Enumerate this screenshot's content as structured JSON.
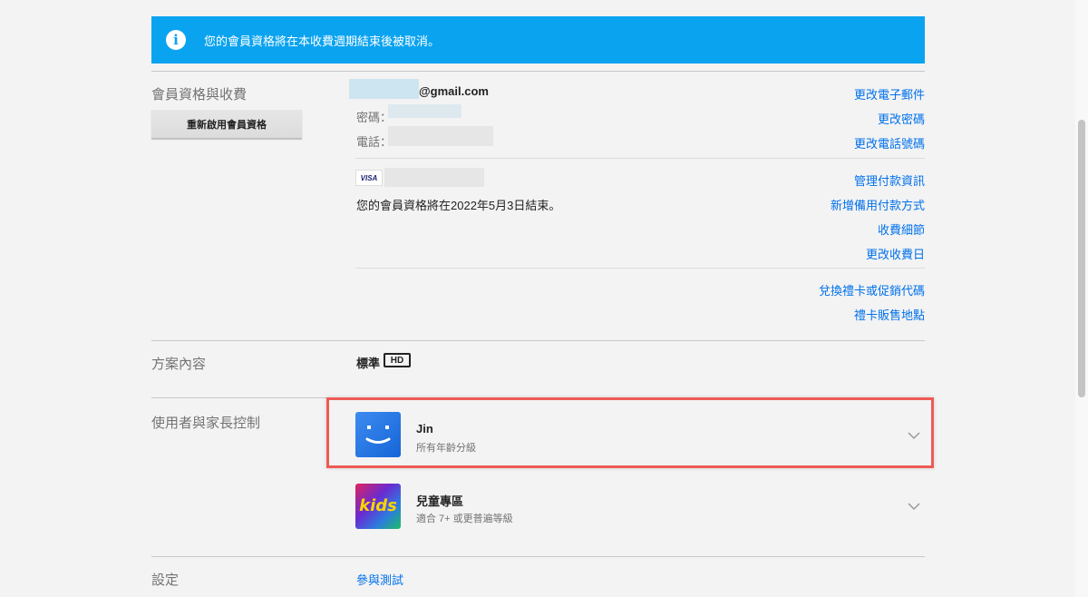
{
  "banner": {
    "message": "您的會員資格將在本收費週期結束後被取消。"
  },
  "membership": {
    "section_title": "會員資格與收費",
    "reactivate_button": "重新啟用會員資格",
    "email_suffix": "@gmail.com",
    "password_label": "密碼：",
    "phone_label": "電話：",
    "links_account": [
      "更改電子郵件",
      "更改密碼",
      "更改電話號碼"
    ],
    "card_brand": "VISA",
    "end_notice": "您的會員資格將在2022年5月3日結束。",
    "links_billing": [
      "管理付款資訊",
      "新增備用付款方式",
      "收費細節",
      "更改收費日"
    ],
    "links_gift": [
      "兌換禮卡或促銷代碼",
      "禮卡販售地點"
    ]
  },
  "plan": {
    "section_title": "方案內容",
    "name": "標準",
    "quality_badge": "HD"
  },
  "profiles": {
    "section_title": "使用者與家長控制",
    "items": [
      {
        "name": "Jin",
        "subtitle": "所有年齡分級",
        "avatar": "smiley-avatar",
        "highlighted": true
      },
      {
        "name": "兒童專區",
        "subtitle": "適合 7+ 或更普遍等級",
        "avatar": "kids-avatar",
        "avatar_text": "kids",
        "highlighted": false
      }
    ]
  },
  "settings": {
    "section_title": "設定",
    "first_link": "參與測試"
  },
  "colors": {
    "banner": "#0aa3f0",
    "link": "#0071eb",
    "highlight_border": "#ee5a55",
    "background": "#f3f3f3"
  }
}
